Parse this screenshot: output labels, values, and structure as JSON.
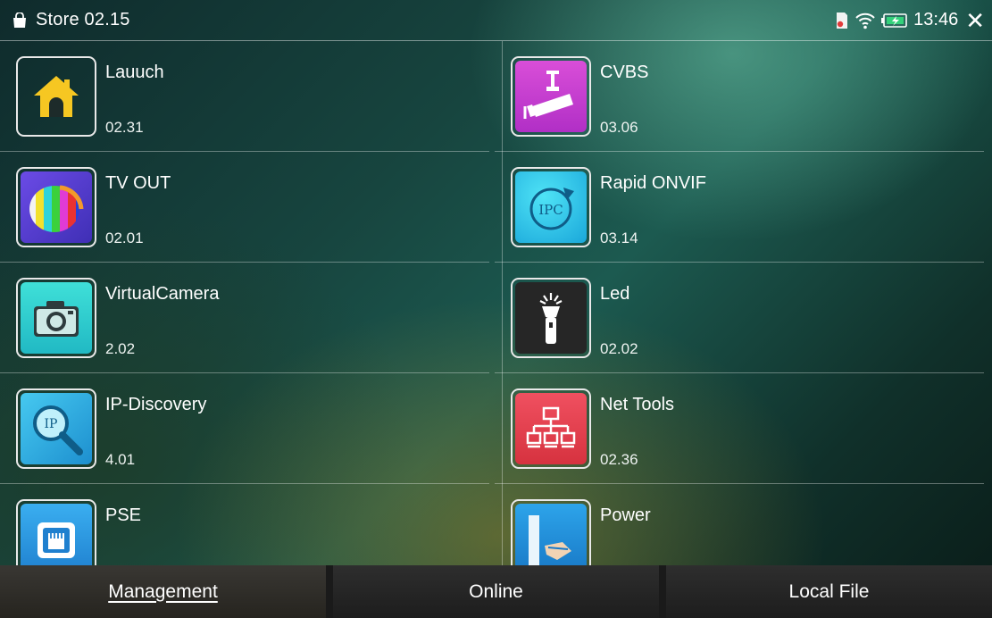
{
  "status_bar": {
    "title": "Store 02.15",
    "time": "13:46",
    "close_glyph": "✕",
    "icons": [
      "shopping-bag-icon",
      "sd-card-icon",
      "wifi-icon",
      "battery-charging-icon",
      "close-icon"
    ]
  },
  "apps": [
    {
      "name": "Lauuch",
      "version": "02.31",
      "icon": "home-icon",
      "tile_color": "#ffffff"
    },
    {
      "name": "CVBS",
      "version": "03.06",
      "icon": "cctv-camera-icon",
      "tile_color": "#cc3fd2"
    },
    {
      "name": "TV OUT",
      "version": "02.01",
      "icon": "color-bars-icon",
      "tile_color": "#5a3ad8"
    },
    {
      "name": "Rapid ONVIF",
      "version": "03.14",
      "icon": "ipc-refresh-icon",
      "tile_color": "#1fb5e0",
      "icon_text": "IPC"
    },
    {
      "name": "VirtualCamera",
      "version": "2.02",
      "icon": "photo-camera-icon",
      "tile_color": "#2ecfd2"
    },
    {
      "name": "Led",
      "version": "02.02",
      "icon": "flashlight-icon",
      "tile_color": "#2a2a2a"
    },
    {
      "name": "IP-Discovery",
      "version": "4.01",
      "icon": "ip-magnifier-icon",
      "tile_color": "#33b6e6",
      "icon_text": "IP"
    },
    {
      "name": "Net Tools",
      "version": "02.36",
      "icon": "network-tree-icon",
      "tile_color": "#e8404e"
    },
    {
      "name": "PSE",
      "version": "",
      "icon": "ethernet-port-icon",
      "tile_color": "#2e9ae0"
    },
    {
      "name": "Power",
      "version": "",
      "icon": "power-plug-icon",
      "tile_color": "#1e8fd6"
    }
  ],
  "tabs": [
    {
      "label": "Management",
      "active": true
    },
    {
      "label": "Online",
      "active": false
    },
    {
      "label": "Local File",
      "active": false
    }
  ]
}
